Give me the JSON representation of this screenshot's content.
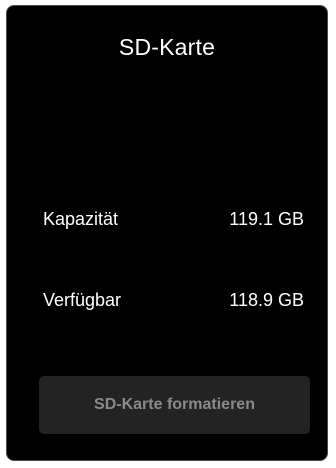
{
  "panel": {
    "title": "SD-Karte",
    "rows": [
      {
        "label": "Kapazität",
        "value": "119.1 GB"
      },
      {
        "label": "Verfügbar",
        "value": "118.9 GB"
      }
    ],
    "format_button_label": "SD-Karte formatieren",
    "format_button_enabled": false
  },
  "colors": {
    "panel_background": "#000000",
    "panel_border": "#4a4a4a",
    "text": "#ffffff",
    "button_background": "#232323",
    "button_text_disabled": "#8a8a8a"
  }
}
